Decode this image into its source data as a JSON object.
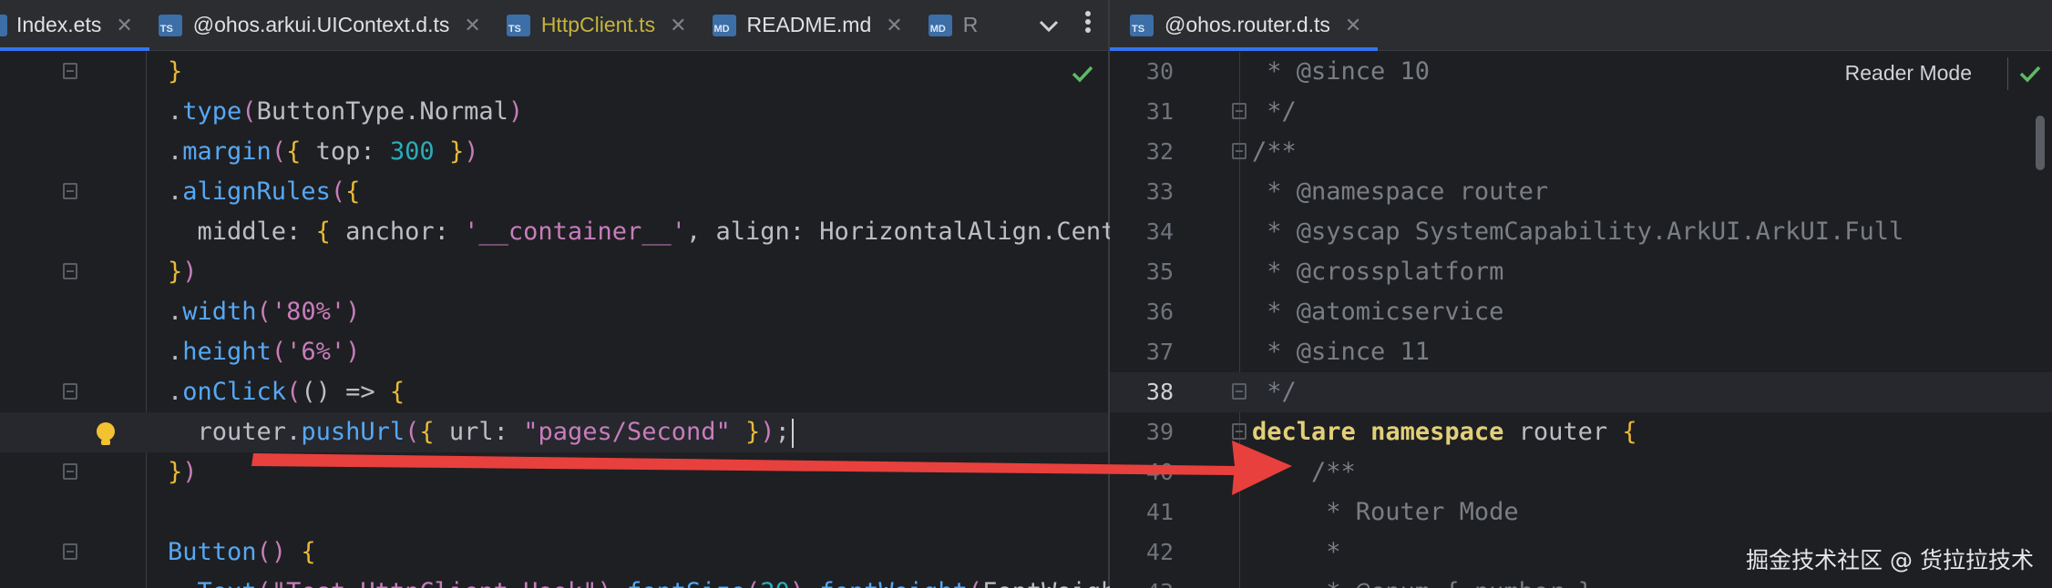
{
  "left_tabs": [
    {
      "label": "Index.ets",
      "icon": "ets-file-icon"
    },
    {
      "label": "@ohos.arkui.UIContext.d.ts",
      "icon": "ts-file-icon",
      "badge": "TS"
    },
    {
      "label": "HttpClient.ts",
      "icon": "ts-file-icon",
      "badge": "TS"
    },
    {
      "label": "README.md",
      "icon": "md-file-icon",
      "badge": "MD"
    },
    {
      "label": "R",
      "icon": "md-file-icon",
      "badge": "MD"
    }
  ],
  "right_tabs": [
    {
      "label": "@ohos.router.d.ts",
      "icon": "ts-file-icon",
      "badge": "TS"
    }
  ],
  "right_toolbar": {
    "reader_mode": "Reader Mode"
  },
  "left_code": [
    [
      [
        "t-brace1",
        "}"
      ]
    ],
    [
      [
        "t-dot",
        "."
      ],
      [
        "t-fn",
        "type"
      ],
      [
        "t-brace2",
        "("
      ],
      [
        "t-plain",
        "ButtonType.Normal"
      ],
      [
        "t-brace2",
        ")"
      ]
    ],
    [
      [
        "t-dot",
        "."
      ],
      [
        "t-fn",
        "margin"
      ],
      [
        "t-brace2",
        "("
      ],
      [
        "t-brace1",
        "{"
      ],
      [
        "t-plain",
        " top: "
      ],
      [
        "t-num",
        "300"
      ],
      [
        "t-plain",
        " "
      ],
      [
        "t-brace1",
        "}"
      ],
      [
        "t-brace2",
        ")"
      ]
    ],
    [
      [
        "t-dot",
        "."
      ],
      [
        "t-fn",
        "alignRules"
      ],
      [
        "t-brace2",
        "("
      ],
      [
        "t-brace1",
        "{"
      ]
    ],
    [
      [
        "t-plain",
        "  middle: "
      ],
      [
        "t-brace1",
        "{"
      ],
      [
        "t-plain",
        " anchor: "
      ],
      [
        "t-strtpl",
        "'__container__'"
      ],
      [
        "t-plain",
        ", align: HorizontalAlign.Center"
      ]
    ],
    [
      [
        "t-brace1",
        "}"
      ],
      [
        "t-brace2",
        ")"
      ]
    ],
    [
      [
        "t-dot",
        "."
      ],
      [
        "t-fn",
        "width"
      ],
      [
        "t-brace2",
        "("
      ],
      [
        "t-strtpl",
        "'80%'"
      ],
      [
        "t-brace2",
        ")"
      ]
    ],
    [
      [
        "t-dot",
        "."
      ],
      [
        "t-fn",
        "height"
      ],
      [
        "t-brace2",
        "("
      ],
      [
        "t-strtpl",
        "'6%'"
      ],
      [
        "t-brace2",
        ")"
      ]
    ],
    [
      [
        "t-dot",
        "."
      ],
      [
        "t-fn",
        "onClick"
      ],
      [
        "t-brace2",
        "("
      ],
      [
        "t-plain",
        "() => "
      ],
      [
        "t-brace1",
        "{"
      ]
    ],
    [
      [
        "t-plain",
        "  router."
      ],
      [
        "t-fn",
        "pushUrl"
      ],
      [
        "t-brace2",
        "("
      ],
      [
        "t-brace1",
        "{"
      ],
      [
        "t-plain",
        " url: "
      ],
      [
        "t-strtpl",
        "\"pages/Second\""
      ],
      [
        "t-plain",
        " "
      ],
      [
        "t-brace1",
        "}"
      ],
      [
        "t-brace2",
        ")"
      ],
      [
        "t-plain",
        ";"
      ]
    ],
    [
      [
        "t-brace1",
        "}"
      ],
      [
        "t-brace2",
        ")"
      ]
    ],
    [],
    [
      [
        "t-fn",
        "Button"
      ],
      [
        "t-brace2",
        "("
      ],
      [
        "t-brace2",
        ")"
      ],
      [
        "t-plain",
        " "
      ],
      [
        "t-brace1",
        "{"
      ]
    ],
    [
      [
        "t-plain",
        "  "
      ],
      [
        "t-fn",
        "Text"
      ],
      [
        "t-brace2",
        "("
      ],
      [
        "t-strtpl",
        "\"Test HttpClient Hook\""
      ],
      [
        "t-brace2",
        ")"
      ],
      [
        "t-plain",
        "."
      ],
      [
        "t-fn",
        "fontSize"
      ],
      [
        "t-brace2",
        "("
      ],
      [
        "t-num",
        "20"
      ],
      [
        "t-brace2",
        ")"
      ],
      [
        "t-plain",
        "."
      ],
      [
        "t-fn",
        "fontWeight"
      ],
      [
        "t-brace2",
        "("
      ],
      [
        "t-plain",
        "FontWeight"
      ]
    ]
  ],
  "right_code": [
    {
      "num": "30",
      "tokens": [
        [
          "t-comment",
          " * @since 10"
        ]
      ]
    },
    {
      "num": "31",
      "tokens": [
        [
          "t-comment",
          " */"
        ]
      ]
    },
    {
      "num": "32",
      "tokens": [
        [
          "t-comment",
          "/**"
        ]
      ]
    },
    {
      "num": "33",
      "tokens": [
        [
          "t-comment",
          " * @namespace router"
        ]
      ]
    },
    {
      "num": "34",
      "tokens": [
        [
          "t-comment",
          " * @syscap SystemCapability.ArkUI.ArkUI.Full"
        ]
      ]
    },
    {
      "num": "35",
      "tokens": [
        [
          "t-comment",
          " * @crossplatform"
        ]
      ]
    },
    {
      "num": "36",
      "tokens": [
        [
          "t-comment",
          " * @atomicservice"
        ]
      ]
    },
    {
      "num": "37",
      "tokens": [
        [
          "t-comment",
          " * @since 11"
        ]
      ]
    },
    {
      "num": "38",
      "tokens": [
        [
          "t-comment",
          " */"
        ]
      ]
    },
    {
      "num": "39",
      "tokens": [
        [
          "t-kw2",
          "declare"
        ],
        [
          "t-plain",
          " "
        ],
        [
          "t-kw2",
          "namespace"
        ],
        [
          "t-plain",
          " router "
        ],
        [
          "t-brace1",
          "{"
        ]
      ]
    },
    {
      "num": "40",
      "tokens": [
        [
          "t-comment",
          "    /**"
        ]
      ]
    },
    {
      "num": "41",
      "tokens": [
        [
          "t-comment",
          "     * Router Mode"
        ]
      ]
    },
    {
      "num": "42",
      "tokens": [
        [
          "t-comment",
          "     *"
        ]
      ]
    },
    {
      "num": "43",
      "tokens": [
        [
          "t-comment",
          "     * @enum { number }"
        ]
      ]
    }
  ],
  "watermark": "掘金技术社区 @ 货拉拉技术",
  "colors": {
    "arrow": "#e8403d",
    "accent": "#3574f0"
  }
}
